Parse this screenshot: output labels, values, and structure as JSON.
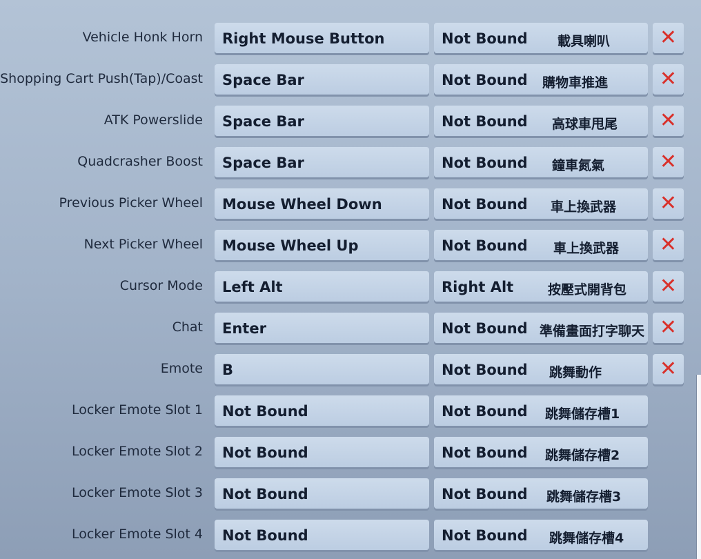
{
  "colors": {
    "clear_icon": "#d9302a",
    "text": "#141e30"
  },
  "bindings": [
    {
      "action": "Vehicle Honk Horn",
      "primary": "Right Mouse Button",
      "secondary": "Not Bound",
      "note": "載具喇叭",
      "clear": true
    },
    {
      "action": "Shopping Cart Push(Tap)/Coast",
      "primary": "Space Bar",
      "secondary": "Not Bound",
      "note": "購物車推進",
      "clear": true
    },
    {
      "action": "ATK Powerslide",
      "primary": "Space Bar",
      "secondary": "Not Bound",
      "note": "高球車甩尾",
      "clear": true
    },
    {
      "action": "Quadcrasher Boost",
      "primary": "Space Bar",
      "secondary": "Not Bound",
      "note": "鐘車氮氣",
      "clear": true
    },
    {
      "action": "Previous Picker Wheel",
      "primary": "Mouse Wheel Down",
      "secondary": "Not Bound",
      "note": "車上換武器",
      "clear": true
    },
    {
      "action": "Next Picker Wheel",
      "primary": "Mouse Wheel Up",
      "secondary": "Not Bound",
      "note": "車上換武器",
      "clear": true
    },
    {
      "action": "Cursor Mode",
      "primary": "Left Alt",
      "secondary": "Right Alt",
      "note": "按壓式開背包",
      "clear": true
    },
    {
      "action": "Chat",
      "primary": "Enter",
      "secondary": "Not Bound",
      "note": "準備畫面打字聊天",
      "clear": true
    },
    {
      "action": "Emote",
      "primary": "B",
      "secondary": "Not Bound",
      "note": "跳舞動作",
      "clear": true
    },
    {
      "action": "Locker Emote Slot 1",
      "primary": "Not Bound",
      "secondary": "Not Bound",
      "note": "跳舞儲存槽1",
      "clear": false
    },
    {
      "action": "Locker Emote Slot 2",
      "primary": "Not Bound",
      "secondary": "Not Bound",
      "note": "跳舞儲存槽2",
      "clear": false
    },
    {
      "action": "Locker Emote Slot 3",
      "primary": "Not Bound",
      "secondary": "Not Bound",
      "note": "跳舞儲存槽3",
      "clear": false
    },
    {
      "action": "Locker Emote Slot 4",
      "primary": "Not Bound",
      "secondary": "Not Bound",
      "note": "跳舞儲存槽4",
      "clear": false
    }
  ],
  "clear_glyph": "✕"
}
